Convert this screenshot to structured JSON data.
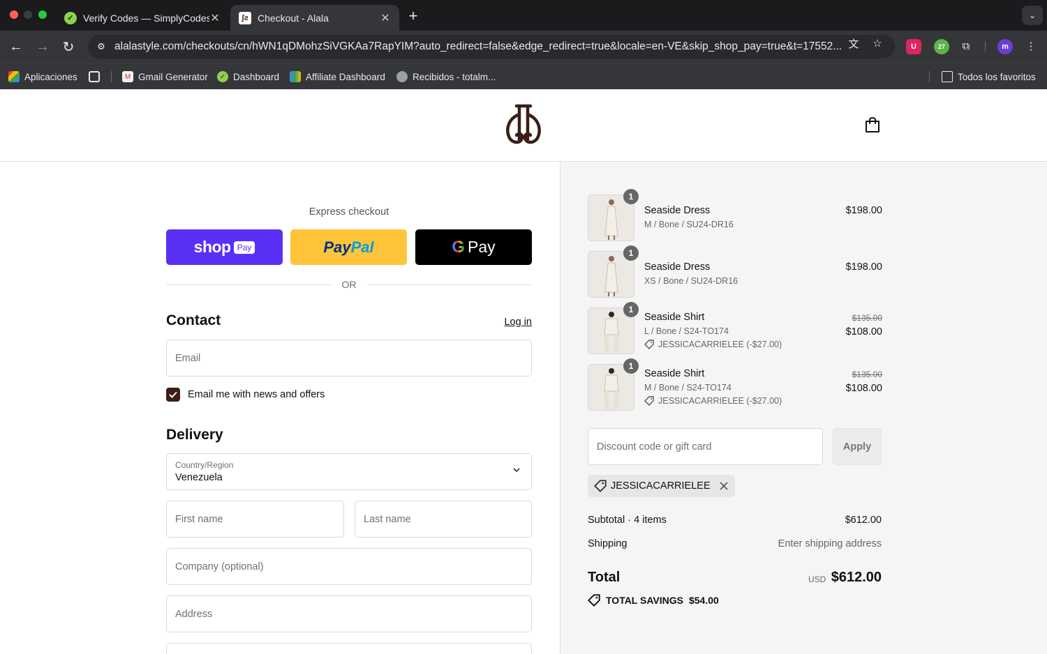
{
  "browser": {
    "tabs": [
      {
        "title": "Verify Codes — SimplyCodes",
        "active": false
      },
      {
        "title": "Checkout - Alala",
        "active": true
      }
    ],
    "url": "alalastyle.com/checkouts/cn/hWN1qDMohzSiVGKAa7RapYIM?auto_redirect=false&edge_redirect=true&locale=en-VE&skip_shop_pay=true&t=17552...",
    "extension_badge": "27",
    "profile_initial": "m",
    "bookmarks": [
      {
        "label": "Aplicaciones"
      },
      {
        "label": "Gmail Generator"
      },
      {
        "label": "Dashboard"
      },
      {
        "label": "Affiliate Dashboard"
      },
      {
        "label": "Recibidos - totalm..."
      }
    ],
    "all_bookmarks": "Todos los favoritos"
  },
  "checkout": {
    "express_title": "Express checkout",
    "shop_pay": {
      "shop": "shop",
      "pay": "Pay"
    },
    "paypal": {
      "pay": "Pay",
      "pal": "Pal"
    },
    "gpay": {
      "g": "G",
      "pay": "Pay"
    },
    "or": "OR",
    "contact_title": "Contact",
    "login": "Log in",
    "email_placeholder": "Email",
    "newsletter_label": "Email me with news and offers",
    "delivery_title": "Delivery",
    "country_label": "Country/Region",
    "country_value": "Venezuela",
    "first_name_placeholder": "First name",
    "last_name_placeholder": "Last name",
    "company_placeholder": "Company (optional)",
    "address_placeholder": "Address"
  },
  "summary": {
    "items": [
      {
        "qty": "1",
        "name": "Seaside Dress",
        "variant": "M / Bone / SU24-DR16",
        "price": "$198.00"
      },
      {
        "qty": "1",
        "name": "Seaside Dress",
        "variant": "XS / Bone / SU24-DR16",
        "price": "$198.00"
      },
      {
        "qty": "1",
        "name": "Seaside Shirt",
        "variant": "L / Bone / S24-TO174",
        "discount": "JESSICACARRIELEE (-$27.00)",
        "original_price": "$135.00",
        "price": "$108.00"
      },
      {
        "qty": "1",
        "name": "Seaside Shirt",
        "variant": "M / Bone / S24-TO174",
        "discount": "JESSICACARRIELEE (-$27.00)",
        "original_price": "$135.00",
        "price": "$108.00"
      }
    ],
    "discount_placeholder": "Discount code or gift card",
    "apply": "Apply",
    "applied_code": "JESSICACARRIELEE",
    "subtotal_label": "Subtotal · 4 items",
    "subtotal_value": "$612.00",
    "shipping_label": "Shipping",
    "shipping_value": "Enter shipping address",
    "total_label": "Total",
    "currency": "USD",
    "total_value": "$612.00",
    "savings_label": "TOTAL SAVINGS",
    "savings_value": "$54.00"
  },
  "colors": {
    "shop_pay": "#5a31f4",
    "paypal": "#ffc439",
    "brand_dark": "#3b1f16"
  }
}
